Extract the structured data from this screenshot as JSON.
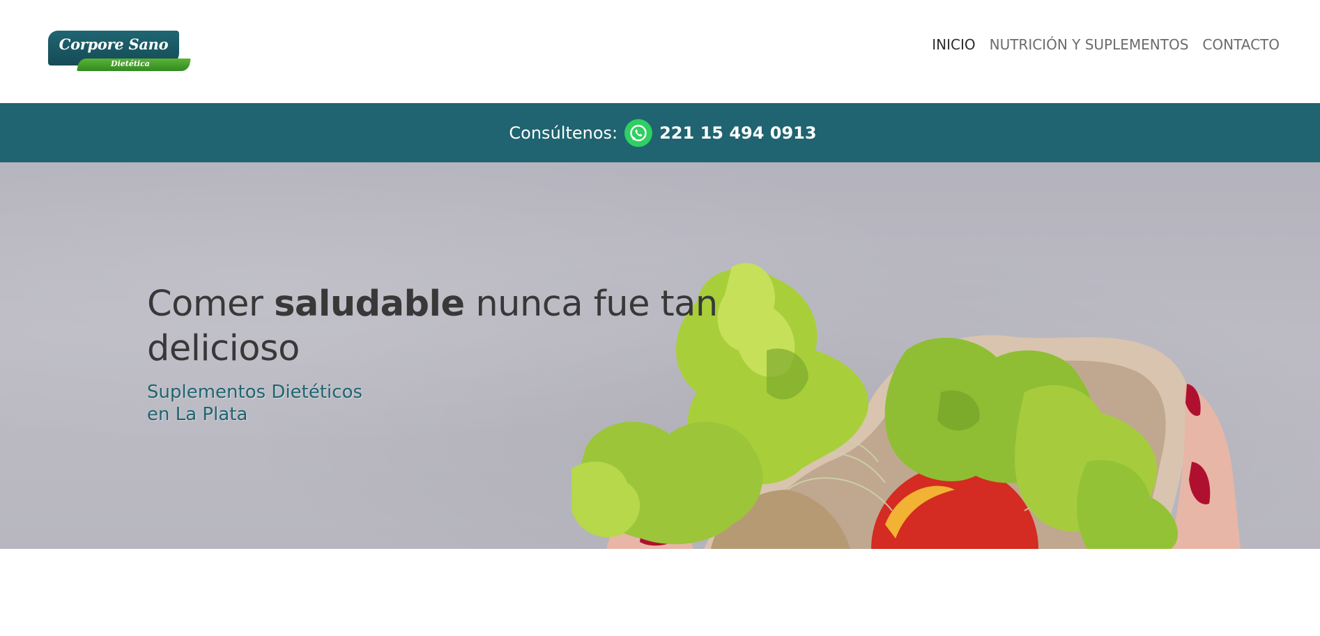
{
  "logo": {
    "title": "Corpore Sano",
    "subtitle": "Dietética"
  },
  "nav": {
    "items": [
      {
        "label": "INICIO",
        "active": true
      },
      {
        "label": "NUTRICIÓN Y SUPLEMENTOS",
        "active": false
      },
      {
        "label": "CONTACTO",
        "active": false
      }
    ]
  },
  "contact": {
    "label": "Consúltenos:",
    "icon": "whatsapp-icon",
    "phone": "221 15 494 0913"
  },
  "hero": {
    "title_pre": "Comer ",
    "title_bold": "saludable",
    "title_post": " nunca fue tan delicioso",
    "subtitle_line1": "Suplementos Dietéticos",
    "subtitle_line2": "en La Plata"
  },
  "colors": {
    "brand_teal": "#1f6470",
    "brand_green": "#3a9a2a",
    "whatsapp_green": "#2fcf62",
    "nav_text": "#6b6b6b"
  }
}
